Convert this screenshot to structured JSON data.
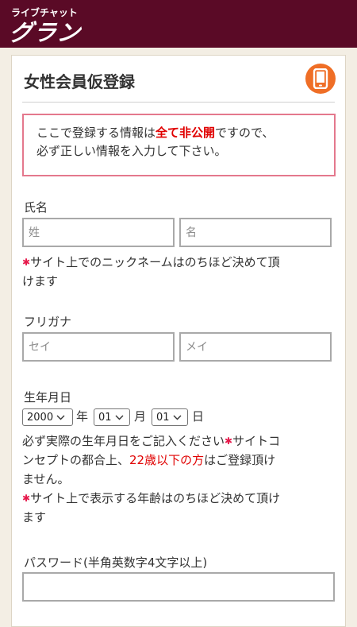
{
  "header": {
    "logo_small": "ライブチャット",
    "logo_big": "グラン"
  },
  "page": {
    "title": "女性会員仮登録",
    "icon": "smartphone-icon"
  },
  "notice": {
    "line1_prefix": "ここで登録する情報は",
    "line1_highlight": "全て非公開",
    "line1_suffix": "ですので、",
    "line2": "必ず正しい情報を入力して下さい。"
  },
  "name": {
    "label": "氏名",
    "last_placeholder": "姓",
    "first_placeholder": "名",
    "note_line1": "サイト上でのニックネームはのちほど決めて頂",
    "note_line2": "けます"
  },
  "furigana": {
    "label": "フリガナ",
    "last_placeholder": "セイ",
    "first_placeholder": "メイ"
  },
  "birthday": {
    "label": "生年月日",
    "year_value": "2000",
    "year_unit": "年",
    "month_value": "01",
    "month_unit": "月",
    "day_value": "01",
    "day_unit": "日",
    "note1_line1_a": "必ず実際の生年月日をご記入ください",
    "note1_line1_b": "サイトコ",
    "note1_line2_a": "ンセプトの都合上、",
    "note1_line2_highlight": "22歳以下の方",
    "note1_line2_b": "はご登録頂け",
    "note1_line3": "ません。",
    "note2_line1": "サイト上で表示する年齢はのちほど決めて頂け",
    "note2_line2": "ます"
  },
  "password": {
    "label": "パスワード(半角英数字4文字以上)",
    "value": ""
  },
  "colors": {
    "header_bg": "#5a0a26",
    "accent_orange": "#ef6e26",
    "notice_border": "#e4788d",
    "highlight_red": "#e00000"
  }
}
